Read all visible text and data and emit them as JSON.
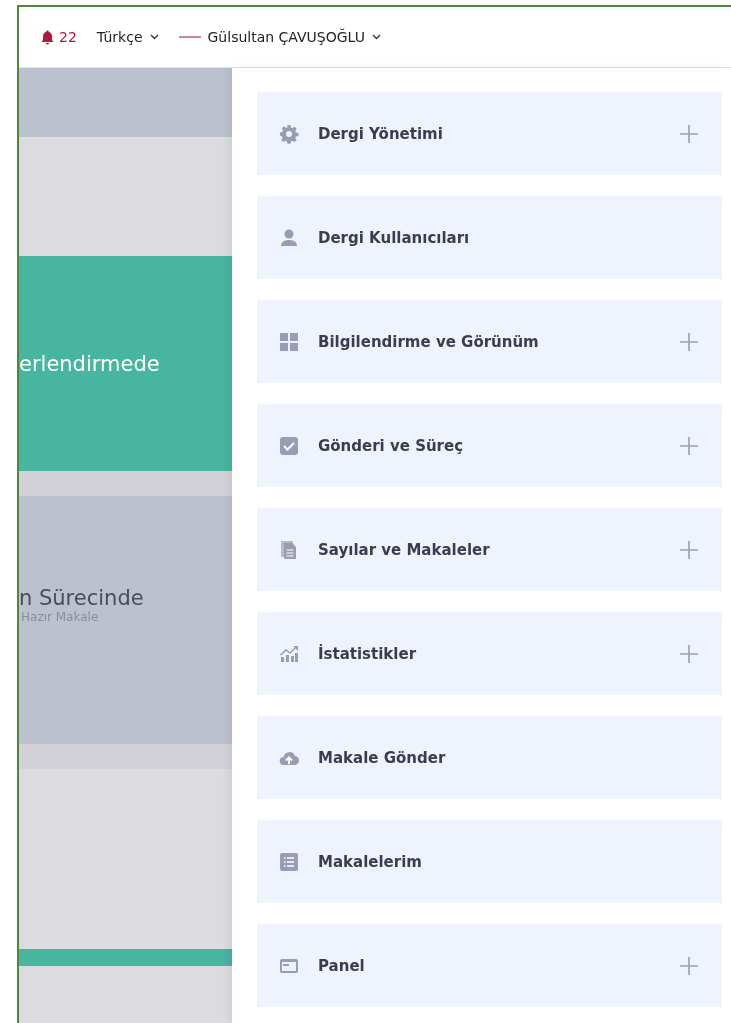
{
  "top_bar": {
    "notifications": {
      "count": "22"
    },
    "language": {
      "label": "Türkçe"
    },
    "user": {
      "name": "Gülsultan ÇAVUŞOĞLU"
    }
  },
  "background_cards": [
    {
      "kind": "band",
      "color": "#bcc1cf"
    },
    {
      "kind": "band",
      "color": "#dcdce0"
    },
    {
      "kind": "card",
      "color": "#47b5a0",
      "title": "erlendirmede"
    },
    {
      "kind": "band",
      "color": "#d2d2d8"
    },
    {
      "kind": "card",
      "color": "#bcc1cf",
      "title": "n Sürecinde",
      "subtitle": "Hazır Makale"
    },
    {
      "kind": "band",
      "color": "#d2d2d8"
    },
    {
      "kind": "band",
      "color": "#dcdce0"
    },
    {
      "kind": "band",
      "color": "#dcdce0"
    },
    {
      "kind": "band",
      "color": "#47b5a0"
    },
    {
      "kind": "band",
      "color": "#dcdce0"
    }
  ],
  "menu": [
    {
      "label": "Dergi Yönetimi",
      "expandable": true
    },
    {
      "label": "Dergi Kullanıcıları",
      "expandable": false
    },
    {
      "label": "Bilgilendirme ve Görünüm",
      "expandable": true
    },
    {
      "label": "Gönderi ve Süreç",
      "expandable": true
    },
    {
      "label": "Sayılar ve Makaleler",
      "expandable": true
    },
    {
      "label": "İstatistikler",
      "expandable": true
    },
    {
      "label": "Makale Gönder",
      "expandable": false
    },
    {
      "label": "Makalelerim",
      "expandable": false
    },
    {
      "label": "Panel",
      "expandable": true
    }
  ]
}
